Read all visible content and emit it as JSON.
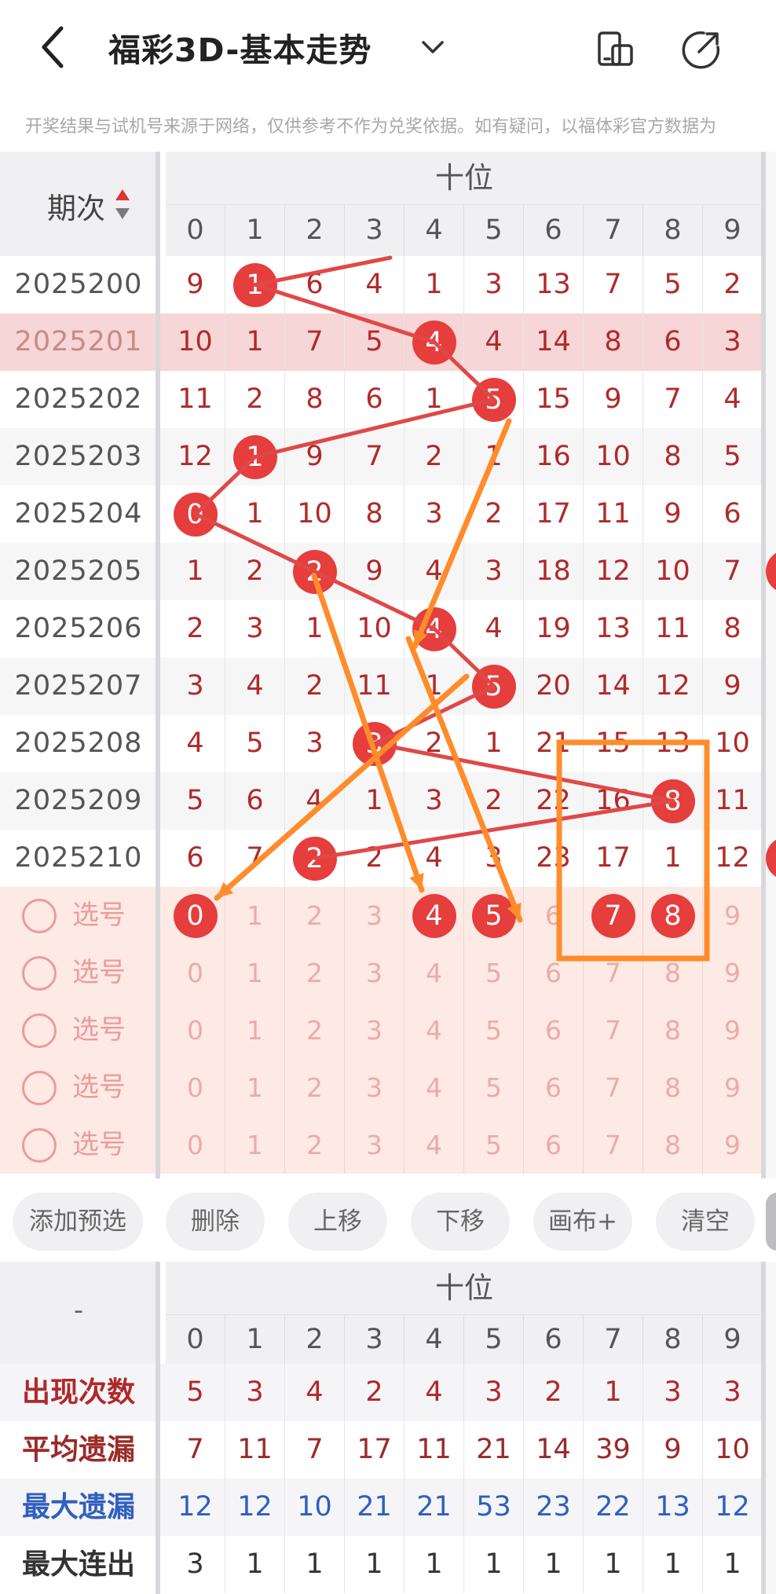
{
  "header": {
    "title": "福彩3D-基本走势",
    "disclaimer": "开奖结果与试机号来源于网络，仅供参考不作为兑奖依据。如有疑问，以福体彩官方数据为"
  },
  "grid": {
    "issue_header": "期次",
    "position_header": "十位",
    "digits": [
      "0",
      "1",
      "2",
      "3",
      "4",
      "5",
      "6",
      "7",
      "8",
      "9"
    ],
    "rows": [
      {
        "issue": "2025200",
        "cells": [
          "9",
          "1",
          "6",
          "4",
          "1",
          "3",
          "13",
          "7",
          "5",
          "2"
        ],
        "hit": 1
      },
      {
        "issue": "2025201",
        "cells": [
          "10",
          "1",
          "7",
          "5",
          "4",
          "4",
          "14",
          "8",
          "6",
          "3"
        ],
        "hit": 4
      },
      {
        "issue": "2025202",
        "cells": [
          "11",
          "2",
          "8",
          "6",
          "1",
          "5",
          "15",
          "9",
          "7",
          "4"
        ],
        "hit": 5
      },
      {
        "issue": "2025203",
        "cells": [
          "12",
          "1",
          "9",
          "7",
          "2",
          "1",
          "16",
          "10",
          "8",
          "5"
        ],
        "hit": 1
      },
      {
        "issue": "2025204",
        "cells": [
          "0",
          "1",
          "10",
          "8",
          "3",
          "2",
          "17",
          "11",
          "9",
          "6"
        ],
        "hit": 0
      },
      {
        "issue": "2025205",
        "cells": [
          "1",
          "2",
          "2",
          "9",
          "4",
          "3",
          "18",
          "12",
          "10",
          "7"
        ],
        "hit": 2
      },
      {
        "issue": "2025206",
        "cells": [
          "2",
          "3",
          "1",
          "10",
          "4",
          "4",
          "19",
          "13",
          "11",
          "8"
        ],
        "hit": 4
      },
      {
        "issue": "2025207",
        "cells": [
          "3",
          "4",
          "2",
          "11",
          "1",
          "5",
          "20",
          "14",
          "12",
          "9"
        ],
        "hit": 5
      },
      {
        "issue": "2025208",
        "cells": [
          "4",
          "5",
          "3",
          "3",
          "2",
          "1",
          "21",
          "15",
          "13",
          "10"
        ],
        "hit": 3
      },
      {
        "issue": "2025209",
        "cells": [
          "5",
          "6",
          "4",
          "1",
          "3",
          "2",
          "22",
          "16",
          "8",
          "11"
        ],
        "hit": 8
      },
      {
        "issue": "2025210",
        "cells": [
          "6",
          "7",
          "2",
          "2",
          "4",
          "3",
          "23",
          "17",
          "1",
          "12"
        ],
        "hit": 2
      }
    ],
    "pick_label": "选号",
    "pick_rows": [
      {
        "selected": [
          0,
          4,
          5,
          7,
          8
        ]
      },
      {
        "selected": []
      },
      {
        "selected": []
      },
      {
        "selected": []
      },
      {
        "selected": []
      }
    ]
  },
  "buttons": {
    "add": "添加预选",
    "delete": "删除",
    "up": "上移",
    "down": "下移",
    "canvas": "画布+",
    "clear": "清空"
  },
  "stats": {
    "corner": "-",
    "position_header": "十位",
    "rows": [
      {
        "label": "出现次数",
        "color": "#b0282a",
        "values": [
          "5",
          "3",
          "4",
          "2",
          "4",
          "3",
          "2",
          "1",
          "3",
          "3"
        ]
      },
      {
        "label": "平均遗漏",
        "color": "#9a2a2a",
        "values": [
          "7",
          "11",
          "7",
          "17",
          "11",
          "21",
          "14",
          "39",
          "9",
          "10"
        ]
      },
      {
        "label": "最大遗漏",
        "color": "#2f5fbf",
        "values": [
          "12",
          "12",
          "10",
          "21",
          "21",
          "53",
          "23",
          "22",
          "13",
          "12"
        ]
      },
      {
        "label": "最大连出",
        "color": "#333333",
        "values": [
          "3",
          "1",
          "1",
          "1",
          "1",
          "1",
          "1",
          "1",
          "1",
          "1"
        ]
      }
    ]
  },
  "colors": {
    "ball": "#e63d3d",
    "trend_line": "#e04848",
    "annotation": "#ff8c2a"
  }
}
